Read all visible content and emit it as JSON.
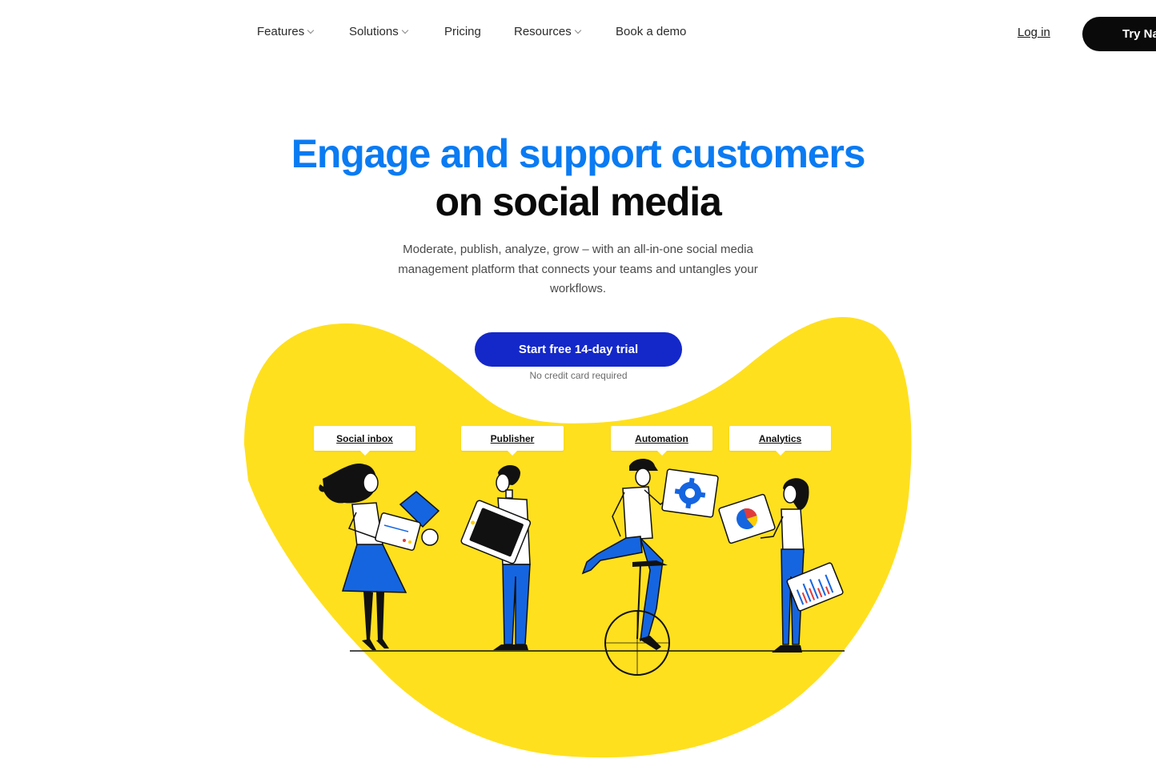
{
  "nav": {
    "items": [
      {
        "label": "Features",
        "dropdown": true
      },
      {
        "label": "Solutions",
        "dropdown": true
      },
      {
        "label": "Pricing",
        "dropdown": false
      },
      {
        "label": "Resources",
        "dropdown": true
      },
      {
        "label": "Book a demo",
        "dropdown": false
      }
    ],
    "login": "Log in",
    "try_button": "Try Na"
  },
  "hero": {
    "headline_blue": "Engage and support customers",
    "headline_black": "on social media",
    "subtext": "Moderate, publish, analyze, grow – with an all-in-one social media management platform that connects your teams and untangles your workflows.",
    "cta": "Start free 14-day trial",
    "cta_note": "No credit card required"
  },
  "features": [
    {
      "label": "Social inbox"
    },
    {
      "label": "Publisher"
    },
    {
      "label": "Automation"
    },
    {
      "label": "Analytics"
    }
  ],
  "colors": {
    "accent_blue": "#0a7bf2",
    "cta_blue": "#1428c9",
    "blob_yellow": "#ffe01e",
    "figure_blue": "#1565e0"
  }
}
